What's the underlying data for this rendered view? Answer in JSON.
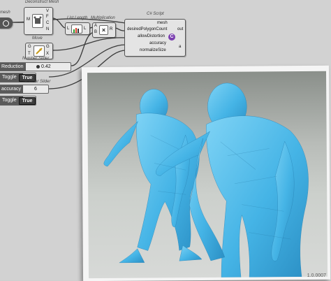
{
  "canvas": {
    "partial_label": "mesh",
    "deconstruct": {
      "title": "Deconstruct Mesh",
      "in": "M",
      "outs": [
        "V",
        "F",
        "C",
        "N"
      ]
    },
    "list_length": {
      "title": "List Length",
      "in": "L",
      "out": "L"
    },
    "multiplication": {
      "title": "Multiplication",
      "ins": [
        "A",
        "B"
      ],
      "out": "R",
      "symbol": "×"
    },
    "move": {
      "title": "Move",
      "ins": [
        "G",
        "T"
      ],
      "outs": [
        "G",
        "X"
      ]
    },
    "csharp": {
      "title": "C# Script",
      "inputs": [
        "mesh",
        "desiredPolygonCount",
        "allowDistortion",
        "accuracy",
        "normalizeSize"
      ],
      "outputs": [
        "out",
        "a"
      ],
      "icon_label": "C"
    },
    "slider_reduction": {
      "title": "Number Slider",
      "name": "Reduction",
      "value": "0.42"
    },
    "toggle1": {
      "name": "Toggle",
      "value": "True"
    },
    "slider_accuracy": {
      "title": "Number Slider",
      "name": "accuracy",
      "value": "6"
    },
    "toggle2": {
      "name": "Toggle",
      "value": "True"
    }
  },
  "viewport": {
    "version_label": "1.0.0007",
    "model_color": "#4fb8e8"
  }
}
